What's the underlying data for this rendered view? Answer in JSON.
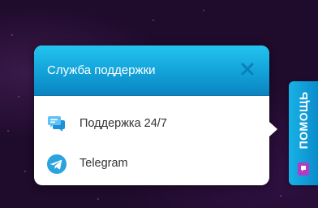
{
  "support_popup": {
    "title": "Служба поддержки",
    "close_icon": "close-icon",
    "items": [
      {
        "label": "Поддержка 24/7",
        "icon": "chat-bubbles-icon"
      },
      {
        "label": "Telegram",
        "icon": "telegram-icon"
      }
    ]
  },
  "help_tab": {
    "label": "ПОМОЩЬ",
    "icon": "chat-icon"
  },
  "colors": {
    "background": "#1f0b2c",
    "header_top": "#23c4ef",
    "header_bottom": "#0b84c2",
    "tab_accent": "#12a1d8",
    "chat_icon_badge": "#b03cc8"
  }
}
